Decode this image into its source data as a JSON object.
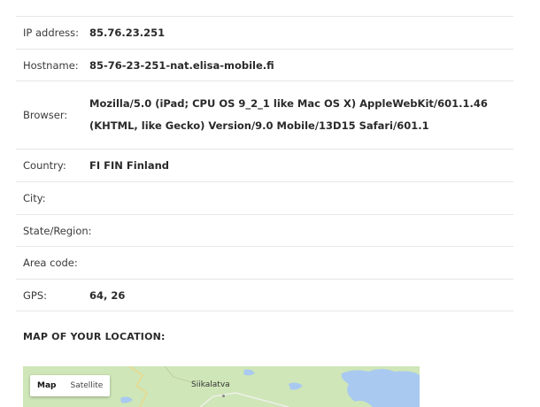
{
  "info": {
    "rows": [
      {
        "label": "IP address:",
        "value": "85.76.23.251"
      },
      {
        "label": "Hostname:",
        "value": "85-76-23-251-nat.elisa-mobile.fi"
      },
      {
        "label": "Browser:",
        "value": "Mozilla/5.0 (iPad; CPU OS 9_2_1 like Mac OS X) AppleWebKit/601.1.46 (KHTML, like Gecko) Version/9.0 Mobile/13D15 Safari/601.1"
      },
      {
        "label": "Country:",
        "value": "FI FIN Finland"
      },
      {
        "label": "City:",
        "value": ""
      },
      {
        "label": "State/Region:",
        "value": ""
      },
      {
        "label": "Area code:",
        "value": ""
      },
      {
        "label": "GPS:",
        "value": "64, 26"
      }
    ]
  },
  "map": {
    "heading": "MAP OF YOUR LOCATION:",
    "type_buttons": {
      "map": "Map",
      "satellite": "Satellite"
    },
    "place_label": "Siikalatva",
    "colors": {
      "land": "#cfe6b8",
      "water": "#a9c9f0"
    }
  }
}
